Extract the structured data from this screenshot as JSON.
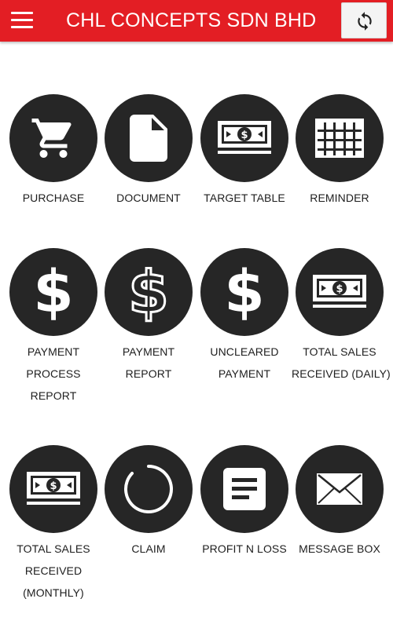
{
  "header": {
    "title": "CHL CONCEPTS SDN BHD",
    "menu_icon": "hamburger-menu-icon",
    "refresh_icon": "sync-icon"
  },
  "colors": {
    "appbar": "#e31e24",
    "tile_circle": "#262626",
    "icon": "#ffffff"
  },
  "tiles": [
    {
      "lines": [
        "PURCHASE"
      ],
      "icon": "cart-icon"
    },
    {
      "lines": [
        "DOCUMENT"
      ],
      "icon": "document-icon"
    },
    {
      "lines": [
        "TARGET TABLE"
      ],
      "icon": "money-icon"
    },
    {
      "lines": [
        "REMINDER"
      ],
      "icon": "calendar-grid-icon"
    },
    {
      "lines": [
        "PAYMENT",
        "PROCESS",
        "REPORT"
      ],
      "icon": "dollar-icon"
    },
    {
      "lines": [
        "PAYMENT",
        "REPORT"
      ],
      "icon": "dollar-outline-icon"
    },
    {
      "lines": [
        "UNCLEARED",
        "PAYMENT"
      ],
      "icon": "dollar-icon"
    },
    {
      "lines": [
        "TOTAL SALES",
        "RECEIVED (DAILY)"
      ],
      "icon": "money-icon"
    },
    {
      "lines": [
        "TOTAL SALES",
        "RECEIVED",
        "(MONTHLY)"
      ],
      "icon": "money-icon"
    },
    {
      "lines": [
        "CLAIM"
      ],
      "icon": "circle-loading-icon"
    },
    {
      "lines": [
        "PROFIT N LOSS"
      ],
      "icon": "article-icon"
    },
    {
      "lines": [
        "MESSAGE BOX"
      ],
      "icon": "envelope-icon"
    }
  ],
  "dollar_glyph": "$"
}
